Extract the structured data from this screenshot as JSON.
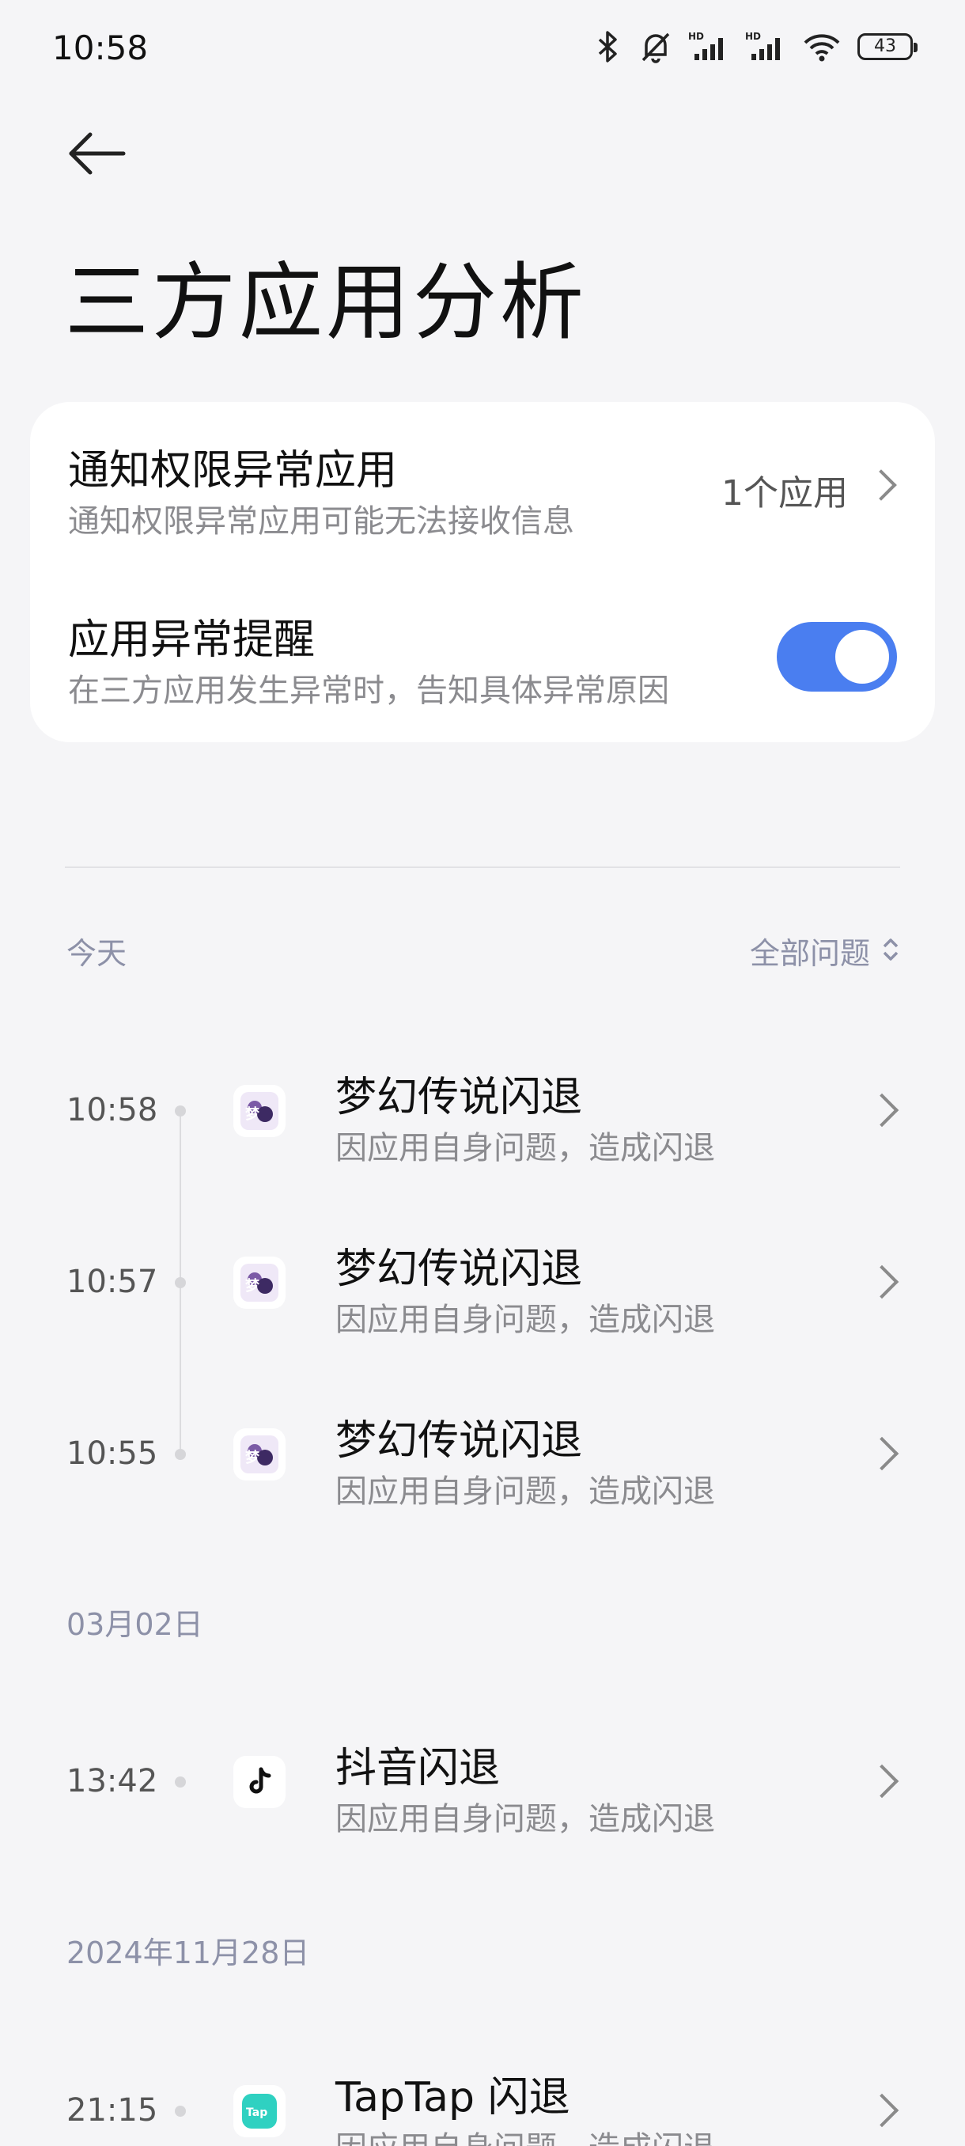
{
  "status_bar": {
    "time": "10:58",
    "battery": "43",
    "icons": [
      "bluetooth-icon",
      "bell-muted-icon",
      "signal-hd-icon",
      "signal-hd-icon",
      "wifi-icon",
      "battery-icon"
    ]
  },
  "header": {
    "back_icon": "arrow-left-icon",
    "title": "三方应用分析"
  },
  "settings": {
    "notification_title": "通知权限异常应用",
    "notification_sub": "通知权限异常应用可能无法接收信息",
    "notification_value": "1个应用",
    "alert_title": "应用异常提醒",
    "alert_sub": "在三方应用发生异常时，告知具体异常原因",
    "alert_enabled": true
  },
  "filter": {
    "label": "全部问题"
  },
  "colors": {
    "accent": "#4a7ef0",
    "background": "#f5f5f7",
    "section_label": "#8d91a8"
  },
  "groups": [
    {
      "date": "今天",
      "items": [
        {
          "time": "10:58",
          "title": "梦幻传说闪退",
          "sub": "因应用自身问题，造成闪退",
          "icon": "menghuan-app-icon"
        },
        {
          "time": "10:57",
          "title": "梦幻传说闪退",
          "sub": "因应用自身问题，造成闪退",
          "icon": "menghuan-app-icon"
        },
        {
          "time": "10:55",
          "title": "梦幻传说闪退",
          "sub": "因应用自身问题，造成闪退",
          "icon": "menghuan-app-icon"
        }
      ]
    },
    {
      "date": "03月02日",
      "items": [
        {
          "time": "13:42",
          "title": "抖音闪退",
          "sub": "因应用自身问题，造成闪退",
          "icon": "douyin-app-icon"
        }
      ]
    },
    {
      "date": "2024年11月28日",
      "items": [
        {
          "time": "21:15",
          "title": "TapTap 闪退",
          "sub": "因应用自身问题，造成闪退",
          "icon": "taptap-app-icon"
        }
      ]
    }
  ]
}
